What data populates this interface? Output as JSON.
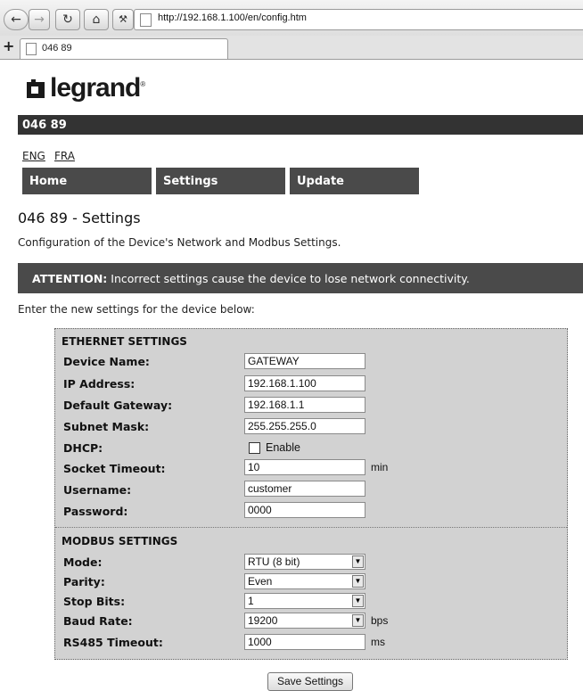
{
  "browser": {
    "url": "http://192.168.1.100/en/config.htm",
    "tab_title": "046 89",
    "new_tab": "+"
  },
  "header": {
    "logo_text": "legrand",
    "model": "046 89"
  },
  "languages": [
    "ENG",
    "FRA"
  ],
  "nav": [
    "Home",
    "Settings",
    "Update"
  ],
  "page": {
    "title": "046 89 - Settings",
    "description": "Configuration of the Device's Network and Modbus Settings.",
    "attention_label": "ATTENTION:",
    "attention_text": " Incorrect settings cause the device to lose network connectivity.",
    "instruction": "Enter the new settings for the device below:"
  },
  "ethernet": {
    "title": "ETHERNET SETTINGS",
    "device_name": {
      "label": "Device Name:",
      "value": "GATEWAY"
    },
    "ip_address": {
      "label": "IP Address:",
      "value": "192.168.1.100"
    },
    "gateway": {
      "label": "Default Gateway:",
      "value": "192.168.1.1"
    },
    "subnet": {
      "label": "Subnet Mask:",
      "value": "255.255.255.0"
    },
    "dhcp": {
      "label": "DHCP:",
      "option": "Enable",
      "checked": false
    },
    "socket_timeout": {
      "label": "Socket Timeout:",
      "value": "10",
      "unit": "min"
    },
    "username": {
      "label": "Username:",
      "value": "customer"
    },
    "password": {
      "label": "Password:",
      "value": "0000"
    }
  },
  "modbus": {
    "title": "MODBUS SETTINGS",
    "mode": {
      "label": "Mode:",
      "value": "RTU (8 bit)"
    },
    "parity": {
      "label": "Parity:",
      "value": "Even"
    },
    "stop_bits": {
      "label": "Stop Bits:",
      "value": "1"
    },
    "baud_rate": {
      "label": "Baud Rate:",
      "value": "19200",
      "unit": "bps"
    },
    "rs485_timeout": {
      "label": "RS485 Timeout:",
      "value": "1000",
      "unit": "ms"
    }
  },
  "save_button": "Save Settings",
  "icons": {
    "back": "back-arrow-icon",
    "forward": "forward-arrow-icon",
    "reload": "reload-icon",
    "home": "home-icon",
    "tools": "wrench-icon",
    "page": "page-icon",
    "dropdown": "chevron-down-icon"
  },
  "colors": {
    "header_bar": "#333333",
    "nav_bg": "#4a4a4a",
    "form_bg": "#d2d2d2"
  }
}
